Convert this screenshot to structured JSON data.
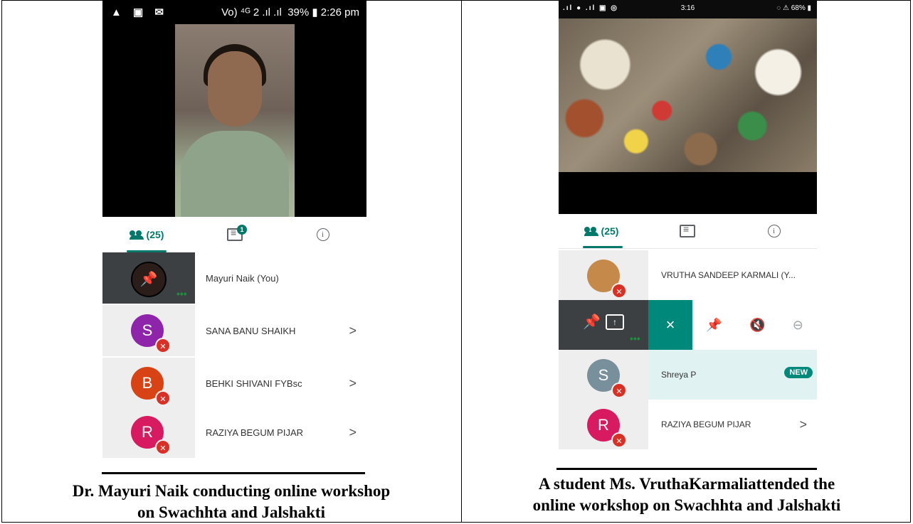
{
  "left_phone": {
    "status": {
      "left_icons": "▲ ▣ ✉",
      "right_text": "39% ▮ 2:26 pm",
      "network": "Vo) ⁴ᴳ 2 .ıl .ıl"
    },
    "tabs": {
      "people_label": "(25)",
      "chat_badge": "1",
      "info_symbol": "i"
    },
    "rows": [
      {
        "initial": "",
        "name": "Mayuri Naik (You)",
        "color": "#2a1d1a"
      },
      {
        "initial": "S",
        "name": "SANA BANU SHAIKH",
        "color": "#8e24aa"
      },
      {
        "initial": "B",
        "name": "BEHKI SHIVANI FYBsc",
        "color": "#d84315"
      },
      {
        "initial": "R",
        "name": "RAZIYA BEGUM PIJAR",
        "color": "#d81b60"
      }
    ],
    "dots": "•••",
    "chevron": ">"
  },
  "right_phone": {
    "status": {
      "left_icons": ".ıl ● .ıl ▣ ◎",
      "center_text": "3:16",
      "right_text": "◌ ⚠ 68% ▮"
    },
    "tabs": {
      "people_label": "(25)",
      "info_symbol": "i"
    },
    "rows": [
      {
        "initial": "",
        "name": "VRUTHA SANDEEP KARMALI (Y...",
        "color": "#c58a4a"
      },
      {
        "initial": "S",
        "name": "Shreya P",
        "color": "#78909c",
        "badge": "NEW"
      },
      {
        "initial": "R",
        "name": "RAZIYA BEGUM PIJAR",
        "color": "#d81b60"
      }
    ],
    "controls": {
      "close": "×"
    },
    "dots": "•••",
    "chevron": ">"
  },
  "captions": {
    "left_line1": "Dr. Mayuri Naik conducting online workshop",
    "left_line2": "on Swachhta and Jalshakti",
    "right_line1": "A student Ms. VruthaKarmaliattended the",
    "right_line2": "online workshop on Swachhta and Jalshakti"
  }
}
